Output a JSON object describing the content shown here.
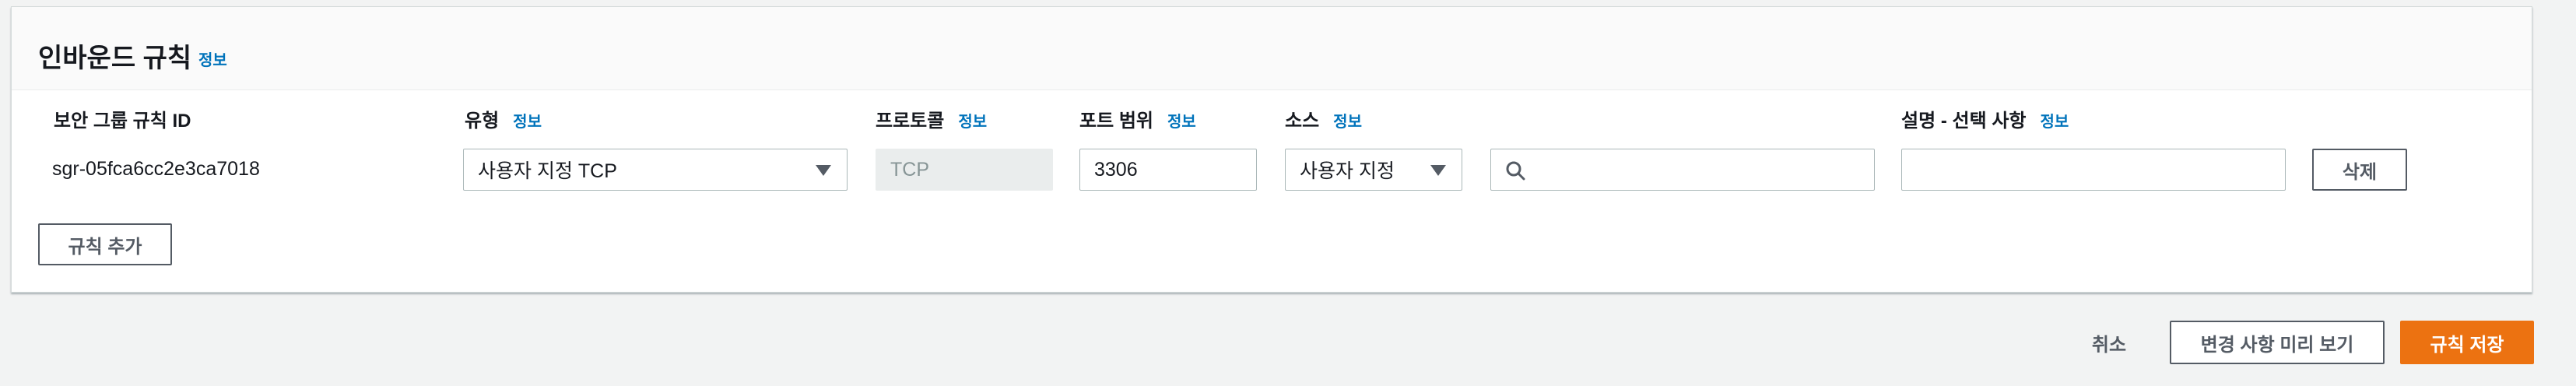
{
  "panel": {
    "title": "인바운드 규칙",
    "info": "정보"
  },
  "columns": {
    "sg_rule_id": "보안 그룹 규칙 ID",
    "type": "유형",
    "protocol": "프로토콜",
    "port_range": "포트 범위",
    "source": "소스",
    "description": "설명 - 선택 사항",
    "info": "정보"
  },
  "rule": {
    "id": "sgr-05fca6cc2e3ca7018",
    "type": "사용자 지정 TCP",
    "protocol": "TCP",
    "port_range": "3306",
    "source_type": "사용자 지정",
    "source_value": "",
    "description": "",
    "delete_label": "삭제"
  },
  "actions": {
    "add_rule": "규칙 추가",
    "cancel": "취소",
    "preview": "변경 사항 미리 보기",
    "save": "규칙 저장"
  },
  "icons": {
    "search": "search-icon",
    "dropdown": "caret-down-icon"
  },
  "colors": {
    "link": "#0073bb",
    "primary": "#ec7211"
  }
}
